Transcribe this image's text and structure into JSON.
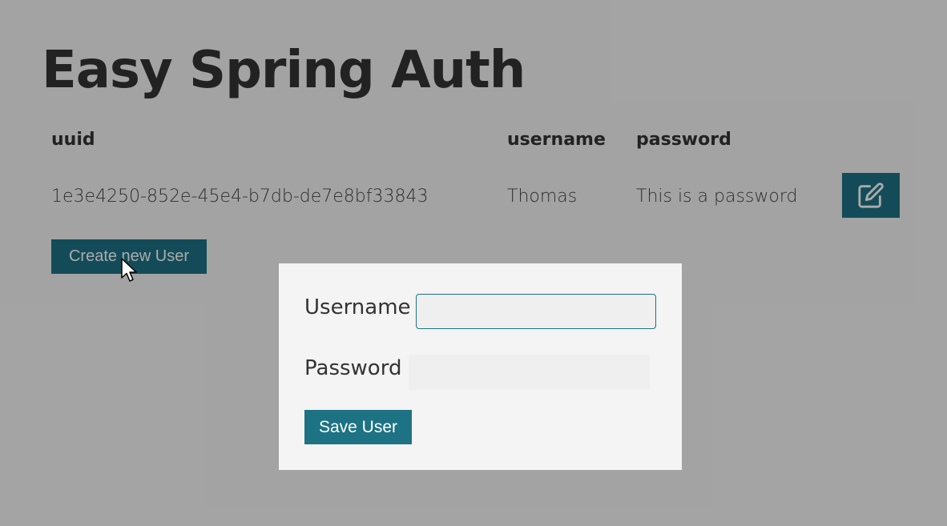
{
  "app": {
    "title": "Easy Spring Auth"
  },
  "table": {
    "headers": [
      "uuid",
      "username",
      "password"
    ],
    "rows": [
      {
        "uuid": "1e3e4250-852e-45e4-b7db-de7e8bf33843",
        "username": "Thomas",
        "password": "This is a password",
        "action_icon": "edit-icon"
      }
    ]
  },
  "actions": {
    "create_label": "Create new User"
  },
  "modal": {
    "username_label": "Username",
    "username_value": "",
    "password_label": "Password",
    "password_value": "",
    "save_label": "Save User"
  },
  "colors": {
    "accent": "#1d7283",
    "overlay": "rgba(0,0,0,0.33)",
    "modal_bg": "#f4f4f4"
  }
}
